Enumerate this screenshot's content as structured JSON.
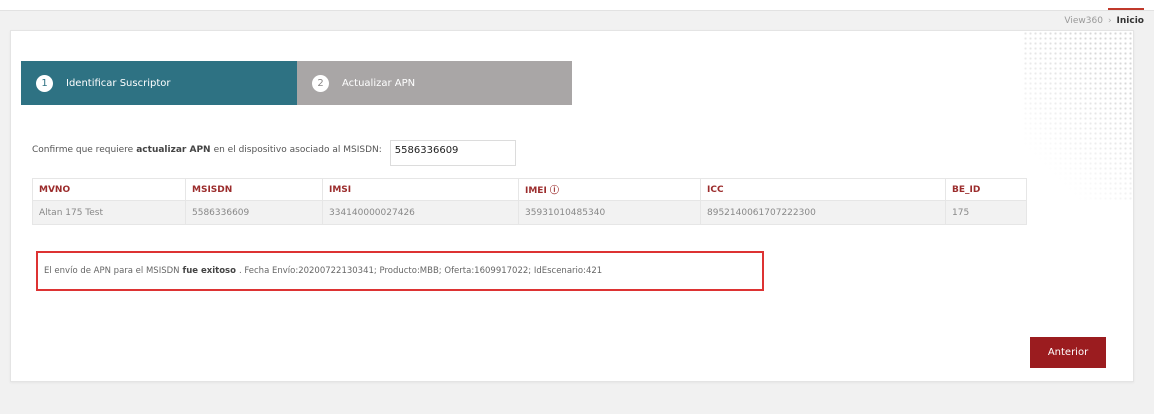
{
  "header": {
    "breadcrumb": {
      "root": "View360",
      "separator": "›",
      "current": "Inicio"
    }
  },
  "steps": [
    {
      "number": "1",
      "label": "Identificar Suscriptor",
      "state": "active"
    },
    {
      "number": "2",
      "label": "Actualizar APN",
      "state": "inactive"
    }
  ],
  "confirm": {
    "text_before": "Confirme que requiere",
    "text_bold": "actualizar APN",
    "text_after": "en el dispositivo asociado al MSISDN:",
    "msisdn_value": "5586336609"
  },
  "table": {
    "columns": [
      "MVNO",
      "MSISDN",
      "IMSI",
      "IMEI ⓘ",
      "ICC",
      "BE_ID"
    ],
    "rows": [
      [
        "Altan 175 Test",
        "5586336609",
        "334140000027426",
        "35931010485340",
        "8952140061707222300",
        "175"
      ]
    ]
  },
  "result": {
    "text_before": "El envío de APN para el MSISDN",
    "text_bold": "fue exitoso",
    "text_after": ". Fecha Envío:20200722130341; Producto:MBB; Oferta:1609917022; IdEscenario:421"
  },
  "actions": {
    "previous_label": "Anterior"
  },
  "colors": {
    "step_active": "#2e7283",
    "step_inactive": "#a9a6a6",
    "table_header_text": "#9b2c2c",
    "button": "#9b1c1f",
    "result_border": "#dd3333"
  }
}
